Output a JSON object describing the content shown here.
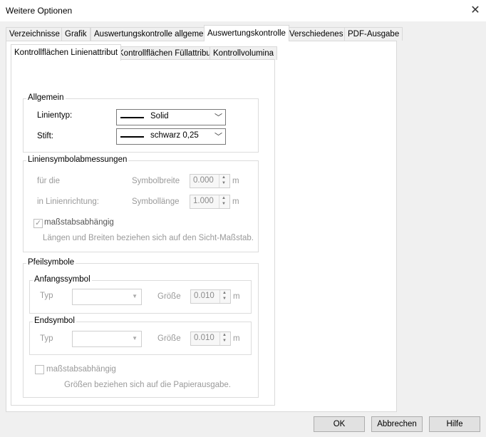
{
  "window": {
    "title": "Weitere Optionen",
    "close_glyph": "✕"
  },
  "tabs": [
    {
      "label": "Verzeichnisse"
    },
    {
      "label": "Grafik"
    },
    {
      "label": "Auswertungskontrolle allgemein"
    },
    {
      "label": "Auswertungskontrolle",
      "active": true
    },
    {
      "label": "Verschiedenes"
    },
    {
      "label": "PDF-Ausgabe"
    }
  ],
  "subtabs": [
    {
      "label": "Kontrollflächen Linienattribut",
      "active": true
    },
    {
      "label": "Kontrollflächen Füllattribut"
    },
    {
      "label": "Kontrollvolumina"
    }
  ],
  "allgemein": {
    "title": "Allgemein",
    "linientyp_label": "Linientyp:",
    "linientyp_value": "Solid",
    "stift_label": "Stift:",
    "stift_value": "schwarz 0,25"
  },
  "liniensymbol": {
    "title": "Liniensymbolabmessungen",
    "row1_label": "für die",
    "row1_field": "Symbolbreite",
    "row1_value": "0.000",
    "row1_unit": "m",
    "row2_label": "in Linienrichtung:",
    "row2_field": "Symbollänge",
    "row2_value": "1.000",
    "row2_unit": "m",
    "checkbox_label": "maßstabsabhängig",
    "checkbox_checked": true,
    "note": "Längen und Breiten beziehen sich auf den Sicht-Maßstab."
  },
  "pfeil": {
    "title": "Pfeilsymbole",
    "anfang": {
      "title": "Anfangssymbol",
      "typ_label": "Typ",
      "groesse_label": "Größe",
      "groesse_value": "0.010",
      "unit": "m"
    },
    "end": {
      "title": "Endsymbol",
      "typ_label": "Typ",
      "groesse_label": "Größe",
      "groesse_value": "0.010",
      "unit": "m"
    },
    "checkbox_label": "maßstabsabhängig",
    "checkbox_checked": false,
    "note": "Größen beziehen sich auf die Papierausgabe."
  },
  "buttons": {
    "ok": "OK",
    "cancel": "Abbrechen",
    "help": "Hilfe"
  }
}
